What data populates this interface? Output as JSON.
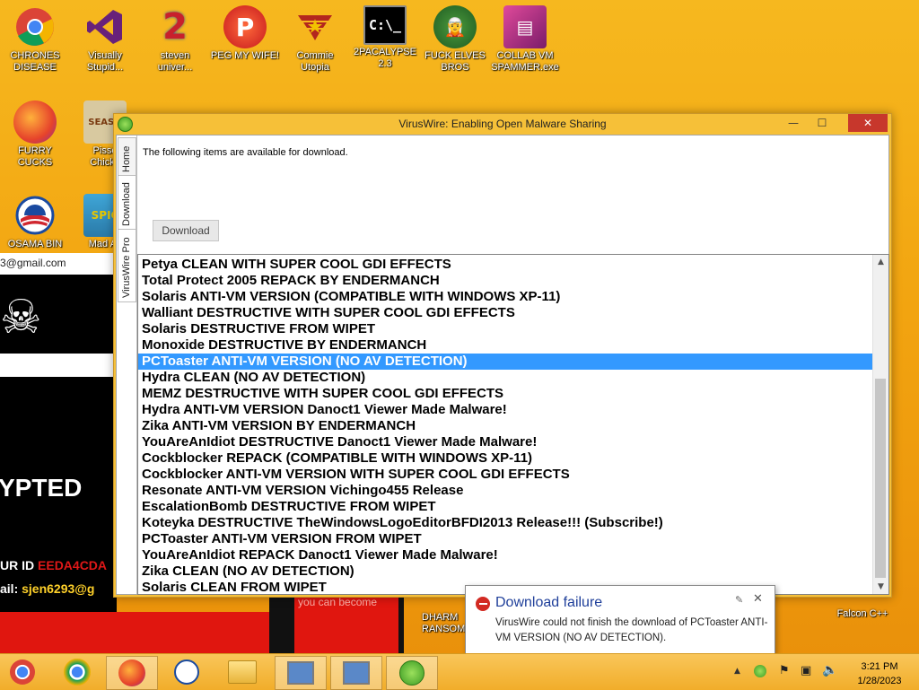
{
  "desktop": {
    "icons": [
      {
        "label": "CHRONES\nDISEASE",
        "icon": "chrome-icon"
      },
      {
        "label": "Visually\nStupid...",
        "icon": "visual-studio-icon"
      },
      {
        "label": "steven\nuniver...",
        "icon": "steven-universe-icon"
      },
      {
        "label": "PEG MY WIFE!",
        "icon": "peggle-icon"
      },
      {
        "label": "Commie\nUtopia",
        "icon": "commie-utopia-icon"
      },
      {
        "label": "2PACALYPSE\n2.3",
        "icon": "cmd-icon"
      },
      {
        "label": "FUCK ELVES\nBROS",
        "icon": "elves-icon"
      },
      {
        "label": "COLLAB VM\nSPAMMER.exe",
        "icon": "collab-vm-icon"
      },
      {
        "label": "FURRY CUCKS",
        "icon": "firefox-icon"
      },
      {
        "label": "Pisse\nChicke",
        "icon": "season-icon"
      },
      {
        "label": "OSAMA BIN",
        "icon": "obama-icon"
      },
      {
        "label": "Mad Av",
        "icon": "angry-birds-icon"
      },
      {
        "label": "DHARM\nRANSOM",
        "icon": "dharma-icon"
      },
      {
        "label": "Falcon C++",
        "icon": "falcon-icon"
      }
    ]
  },
  "background_window": {
    "email": "3@gmail.com",
    "big_text": "YPTED",
    "id_label": "UR ID",
    "id_value": "EEDA4CDA",
    "email_label": "ail:",
    "email_value": "sjen6293@g",
    "red_text": "you can become"
  },
  "window": {
    "title": "VirusWire: Enabling Open Malware Sharing",
    "minimize": "—",
    "maximize": "☐",
    "close": "✕",
    "tabs": [
      "Home",
      "Download",
      "VirusWire Pro"
    ],
    "intro": "The following items are available for download.",
    "download_button": "Download",
    "items": [
      "Petya CLEAN WITH SUPER COOL GDI EFFECTS",
      "Total Protect 2005 REPACK BY ENDERMANCH",
      "Solaris ANTI-VM VERSION (COMPATIBLE WITH WINDOWS XP-11)",
      "Walliant DESTRUCTIVE WITH SUPER COOL GDI EFFECTS",
      "Solaris DESTRUCTIVE FROM WIPET",
      "Monoxide DESTRUCTIVE BY ENDERMANCH",
      "PCToaster ANTI-VM VERSION (NO AV DETECTION)",
      "Hydra CLEAN (NO AV DETECTION)",
      "MEMZ DESTRUCTIVE WITH SUPER COOL GDI EFFECTS",
      "Hydra ANTI-VM VERSION Danoct1 Viewer Made Malware!",
      "Zika ANTI-VM VERSION BY ENDERMANCH",
      "YouAreAnIdiot DESTRUCTIVE Danoct1 Viewer Made Malware!",
      "Cockblocker REPACK (COMPATIBLE WITH WINDOWS XP-11)",
      "Cockblocker ANTI-VM VERSION WITH SUPER COOL GDI EFFECTS",
      "Resonate ANTI-VM VERSION Vichingo455 Release",
      "EscalationBomb DESTRUCTIVE FROM WIPET",
      "Koteyka DESTRUCTIVE TheWindowsLogoEditorBFDI2013 Release!!! (Subscribe!)",
      "PCToaster ANTI-VM VERSION FROM WIPET",
      "YouAreAnIdiot REPACK Danoct1 Viewer Made Malware!",
      "Zika CLEAN (NO AV DETECTION)",
      "Solaris CLEAN FROM WIPET"
    ],
    "selected_index": 6
  },
  "notification": {
    "title": "Download failure",
    "body": "VirusWire could not finish the download of PCToaster ANTI-VM VERSION (NO AV DETECTION)."
  },
  "taskbar": {
    "time": "3:21 PM",
    "date": "1/28/2023"
  },
  "colors": {
    "selection": "#3399ff",
    "close_button": "#c7372c",
    "toast_title": "#1f3f9a"
  }
}
